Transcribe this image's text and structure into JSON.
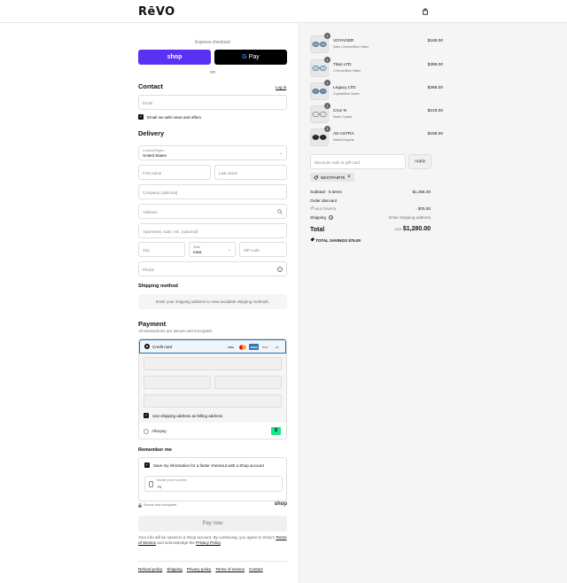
{
  "header": {
    "logo": "RēVO",
    "cart_icon": "shopping-bag-icon"
  },
  "express": {
    "title": "Express checkout",
    "shop_label": "shop",
    "gpay_g": "G",
    "gpay_label": "Pay",
    "or_label": "OR"
  },
  "contact": {
    "title": "Contact",
    "login_label": "Log in",
    "email_placeholder": "Email",
    "news_label": "Email me with news and offers"
  },
  "delivery": {
    "title": "Delivery",
    "country_label": "Country/Region",
    "country_value": "United States",
    "first_name": "First name",
    "last_name": "Last name",
    "company": "Company (optional)",
    "address": "Address",
    "apartment": "Apartment, suite, etc. (optional)",
    "city": "City",
    "state_label": "State",
    "state_value": "Iowa",
    "zip": "ZIP code",
    "phone": "Phone"
  },
  "shipping_method": {
    "title": "Shipping method",
    "message": "Enter your shipping address to view available shipping methods."
  },
  "payment": {
    "title": "Payment",
    "subtitle": "All transactions are secure and encrypted.",
    "credit_card_label": "Credit card",
    "cards": [
      "VISA",
      "MC",
      "AMEX",
      "DISC",
      "+4"
    ],
    "billing_label": "Use shipping address as billing address",
    "afterpay_label": "Afterpay",
    "afterpay_badge": "$"
  },
  "remember": {
    "title": "Remember me",
    "save_label": "Save my information for a faster checkout with a Shop account",
    "phone_label": "Mobile phone number",
    "phone_value": "+1",
    "secure_label": "Secure and encrypted",
    "shop_logo": "shop"
  },
  "pay_now_label": "Pay now",
  "fine_print": {
    "part1": "Your info will be saved to a Shop account. By continuing, you agree to Shop's ",
    "terms": "Terms of Service",
    "part2": " and acknowledge the ",
    "privacy": "Privacy Policy",
    "part3": "."
  },
  "footer_links": [
    "Refund policy",
    "Shipping",
    "Privacy policy",
    "Terms of service",
    "Contact"
  ],
  "order": {
    "items": [
      {
        "name": "VOYAGER",
        "variant": "Satin Chrome/Blue Water",
        "price": "$169.00",
        "qty": "1",
        "lens": "#6fa8c8"
      },
      {
        "name": "Titan LTD",
        "variant": "Chrome/Blue Water",
        "price": "$399.00",
        "qty": "1",
        "lens": "#a7d2e6"
      },
      {
        "name": "Legacy LTD",
        "variant": "Crystal/Blue Water",
        "price": "$369.00",
        "qty": "1",
        "lens": "#5b97c7"
      },
      {
        "name": "Cruz N",
        "variant": "Matte Crystal",
        "price": "$219.00",
        "qty": "1",
        "lens": "#e2e2e2"
      },
      {
        "name": "AD ASTRA",
        "variant": "Matte/Graphite",
        "price": "$199.00",
        "qty": "1",
        "lens": "#2b2b2b"
      }
    ],
    "discount_placeholder": "Discount code or gift card",
    "apply_label": "Apply",
    "code": "NEXTPAIR75",
    "subtotal_label": "Subtotal · 5 items",
    "subtotal_value": "$1,355.00",
    "order_discount_label": "Order discount",
    "discount_code": "NEXTPAIR75",
    "discount_value": "- $75.00",
    "shipping_label": "Shipping",
    "shipping_value": "Enter shipping address",
    "total_label": "Total",
    "currency": "USD",
    "total_value": "$1,280.00",
    "savings_label": "TOTAL SAVINGS",
    "savings_value": "$75.00"
  },
  "colors": {
    "shop_purple": "#5a31f4",
    "accent_blue": "#1773b0",
    "afterpay_green": "#19e68c"
  }
}
